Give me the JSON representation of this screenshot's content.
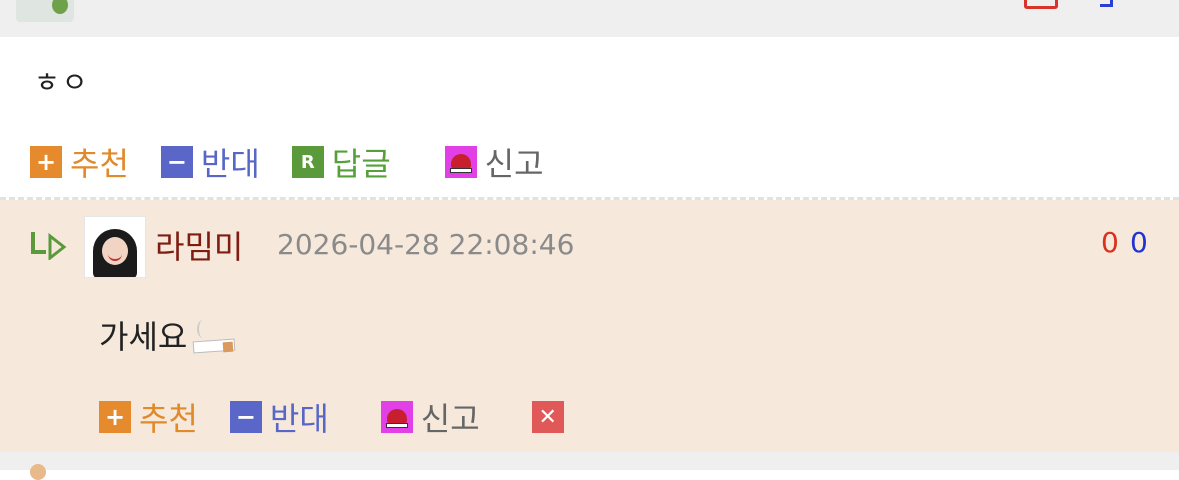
{
  "post": {
    "body": "ㅎㅇ",
    "actions": {
      "recommend": "추천",
      "oppose": "반대",
      "reply": "답글",
      "report": "신고",
      "reply_icon_letter": "R"
    }
  },
  "reply": {
    "author": "라밈미",
    "timestamp": "2026-04-28 22:08:46",
    "upvotes": "0",
    "downvotes": "0",
    "body": "가세요",
    "body_emoji": "cigarette-icon",
    "actions": {
      "recommend": "추천",
      "oppose": "반대",
      "report": "신고",
      "delete": "✕"
    }
  },
  "colors": {
    "reply_background": "#f6e9dc",
    "author_name": "#7e1d12",
    "upvote": "#d8311c",
    "downvote": "#2033cf",
    "recommend": "#e08a2a",
    "oppose": "#5866c6",
    "reply_action": "#56a03a"
  }
}
